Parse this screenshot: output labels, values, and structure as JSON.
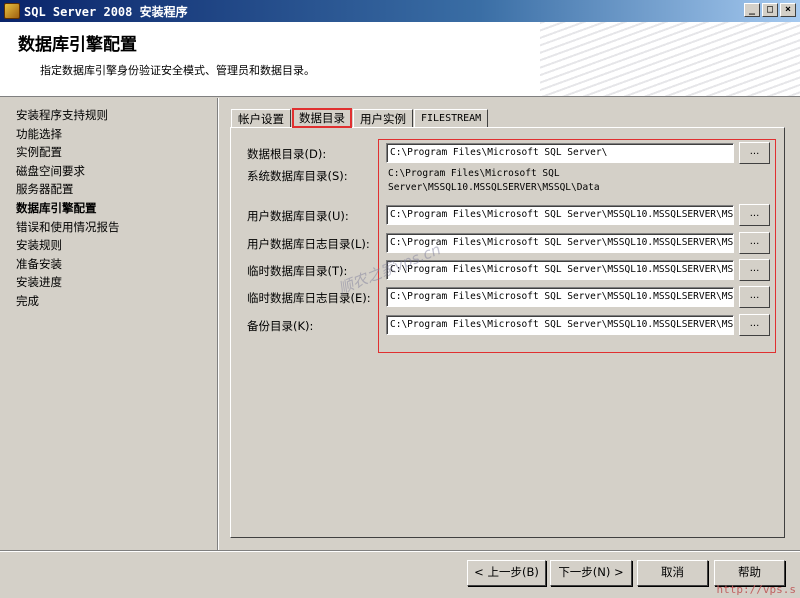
{
  "window": {
    "title": "SQL Server 2008 安装程序",
    "minimize": "_",
    "maximize": "□",
    "close": "×"
  },
  "header": {
    "title": "数据库引擎配置",
    "subtitle": "指定数据库引擎身份验证安全模式、管理员和数据目录。"
  },
  "sidebar": {
    "items": [
      {
        "label": "安装程序支持规则"
      },
      {
        "label": "功能选择"
      },
      {
        "label": "实例配置"
      },
      {
        "label": "磁盘空间要求"
      },
      {
        "label": "服务器配置"
      },
      {
        "label": "数据库引擎配置"
      },
      {
        "label": "错误和使用情况报告"
      },
      {
        "label": "安装规则"
      },
      {
        "label": "准备安装"
      },
      {
        "label": "安装进度"
      },
      {
        "label": "完成"
      }
    ],
    "active_index": 5
  },
  "tabs": [
    {
      "label": "帐户设置"
    },
    {
      "label": "数据目录"
    },
    {
      "label": "用户实例"
    },
    {
      "label": "FILESTREAM"
    }
  ],
  "form": {
    "data_root": {
      "label": "数据根目录(D):",
      "value": "C:\\Program Files\\Microsoft SQL Server\\"
    },
    "system_db": {
      "label": "系统数据库目录(S):",
      "line1": "C:\\Program Files\\Microsoft SQL",
      "line2": "Server\\MSSQL10.MSSQLSERVER\\MSSQL\\Data"
    },
    "user_db": {
      "label": "用户数据库目录(U):",
      "value": "C:\\Program Files\\Microsoft SQL Server\\MSSQL10.MSSQLSERVER\\MSSQL\\Data"
    },
    "user_db_log": {
      "label": "用户数据库日志目录(L):",
      "value": "C:\\Program Files\\Microsoft SQL Server\\MSSQL10.MSSQLSERVER\\MSSQL\\Data"
    },
    "temp_db": {
      "label": "临时数据库目录(T):",
      "value": "C:\\Program Files\\Microsoft SQL Server\\MSSQL10.MSSQLSERVER\\MSSQL\\Data"
    },
    "temp_db_log": {
      "label": "临时数据库日志目录(E):",
      "value": "C:\\Program Files\\Microsoft SQL Server\\MSSQL10.MSSQLSERVER\\MSSQL\\Data"
    },
    "backup": {
      "label": "备份目录(K):",
      "value": "C:\\Program Files\\Microsoft SQL Server\\MSSQL10.MSSQLSERVER\\MSSQL\\Backup"
    },
    "browse_label": "..."
  },
  "buttons": {
    "back": "< 上一步(B)",
    "next": "下一步(N) >",
    "cancel": "取消",
    "help": "帮助"
  },
  "overlay": {
    "watermark": "顺农之家vps.cn",
    "corner_url": "http://vps.s"
  },
  "colors": {
    "highlight": "#e03030",
    "titlebar": "#0a246a"
  }
}
